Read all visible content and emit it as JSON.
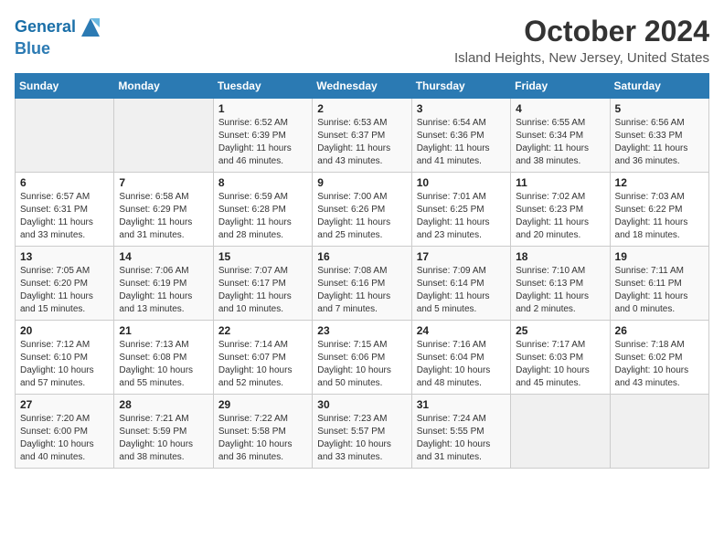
{
  "logo": {
    "line1": "General",
    "line2": "Blue"
  },
  "title": "October 2024",
  "location": "Island Heights, New Jersey, United States",
  "days_of_week": [
    "Sunday",
    "Monday",
    "Tuesday",
    "Wednesday",
    "Thursday",
    "Friday",
    "Saturday"
  ],
  "weeks": [
    [
      {
        "day": "",
        "empty": true
      },
      {
        "day": "",
        "empty": true
      },
      {
        "day": "1",
        "sunrise": "Sunrise: 6:52 AM",
        "sunset": "Sunset: 6:39 PM",
        "daylight": "Daylight: 11 hours and 46 minutes."
      },
      {
        "day": "2",
        "sunrise": "Sunrise: 6:53 AM",
        "sunset": "Sunset: 6:37 PM",
        "daylight": "Daylight: 11 hours and 43 minutes."
      },
      {
        "day": "3",
        "sunrise": "Sunrise: 6:54 AM",
        "sunset": "Sunset: 6:36 PM",
        "daylight": "Daylight: 11 hours and 41 minutes."
      },
      {
        "day": "4",
        "sunrise": "Sunrise: 6:55 AM",
        "sunset": "Sunset: 6:34 PM",
        "daylight": "Daylight: 11 hours and 38 minutes."
      },
      {
        "day": "5",
        "sunrise": "Sunrise: 6:56 AM",
        "sunset": "Sunset: 6:33 PM",
        "daylight": "Daylight: 11 hours and 36 minutes."
      }
    ],
    [
      {
        "day": "6",
        "sunrise": "Sunrise: 6:57 AM",
        "sunset": "Sunset: 6:31 PM",
        "daylight": "Daylight: 11 hours and 33 minutes."
      },
      {
        "day": "7",
        "sunrise": "Sunrise: 6:58 AM",
        "sunset": "Sunset: 6:29 PM",
        "daylight": "Daylight: 11 hours and 31 minutes."
      },
      {
        "day": "8",
        "sunrise": "Sunrise: 6:59 AM",
        "sunset": "Sunset: 6:28 PM",
        "daylight": "Daylight: 11 hours and 28 minutes."
      },
      {
        "day": "9",
        "sunrise": "Sunrise: 7:00 AM",
        "sunset": "Sunset: 6:26 PM",
        "daylight": "Daylight: 11 hours and 25 minutes."
      },
      {
        "day": "10",
        "sunrise": "Sunrise: 7:01 AM",
        "sunset": "Sunset: 6:25 PM",
        "daylight": "Daylight: 11 hours and 23 minutes."
      },
      {
        "day": "11",
        "sunrise": "Sunrise: 7:02 AM",
        "sunset": "Sunset: 6:23 PM",
        "daylight": "Daylight: 11 hours and 20 minutes."
      },
      {
        "day": "12",
        "sunrise": "Sunrise: 7:03 AM",
        "sunset": "Sunset: 6:22 PM",
        "daylight": "Daylight: 11 hours and 18 minutes."
      }
    ],
    [
      {
        "day": "13",
        "sunrise": "Sunrise: 7:05 AM",
        "sunset": "Sunset: 6:20 PM",
        "daylight": "Daylight: 11 hours and 15 minutes."
      },
      {
        "day": "14",
        "sunrise": "Sunrise: 7:06 AM",
        "sunset": "Sunset: 6:19 PM",
        "daylight": "Daylight: 11 hours and 13 minutes."
      },
      {
        "day": "15",
        "sunrise": "Sunrise: 7:07 AM",
        "sunset": "Sunset: 6:17 PM",
        "daylight": "Daylight: 11 hours and 10 minutes."
      },
      {
        "day": "16",
        "sunrise": "Sunrise: 7:08 AM",
        "sunset": "Sunset: 6:16 PM",
        "daylight": "Daylight: 11 hours and 7 minutes."
      },
      {
        "day": "17",
        "sunrise": "Sunrise: 7:09 AM",
        "sunset": "Sunset: 6:14 PM",
        "daylight": "Daylight: 11 hours and 5 minutes."
      },
      {
        "day": "18",
        "sunrise": "Sunrise: 7:10 AM",
        "sunset": "Sunset: 6:13 PM",
        "daylight": "Daylight: 11 hours and 2 minutes."
      },
      {
        "day": "19",
        "sunrise": "Sunrise: 7:11 AM",
        "sunset": "Sunset: 6:11 PM",
        "daylight": "Daylight: 11 hours and 0 minutes."
      }
    ],
    [
      {
        "day": "20",
        "sunrise": "Sunrise: 7:12 AM",
        "sunset": "Sunset: 6:10 PM",
        "daylight": "Daylight: 10 hours and 57 minutes."
      },
      {
        "day": "21",
        "sunrise": "Sunrise: 7:13 AM",
        "sunset": "Sunset: 6:08 PM",
        "daylight": "Daylight: 10 hours and 55 minutes."
      },
      {
        "day": "22",
        "sunrise": "Sunrise: 7:14 AM",
        "sunset": "Sunset: 6:07 PM",
        "daylight": "Daylight: 10 hours and 52 minutes."
      },
      {
        "day": "23",
        "sunrise": "Sunrise: 7:15 AM",
        "sunset": "Sunset: 6:06 PM",
        "daylight": "Daylight: 10 hours and 50 minutes."
      },
      {
        "day": "24",
        "sunrise": "Sunrise: 7:16 AM",
        "sunset": "Sunset: 6:04 PM",
        "daylight": "Daylight: 10 hours and 48 minutes."
      },
      {
        "day": "25",
        "sunrise": "Sunrise: 7:17 AM",
        "sunset": "Sunset: 6:03 PM",
        "daylight": "Daylight: 10 hours and 45 minutes."
      },
      {
        "day": "26",
        "sunrise": "Sunrise: 7:18 AM",
        "sunset": "Sunset: 6:02 PM",
        "daylight": "Daylight: 10 hours and 43 minutes."
      }
    ],
    [
      {
        "day": "27",
        "sunrise": "Sunrise: 7:20 AM",
        "sunset": "Sunset: 6:00 PM",
        "daylight": "Daylight: 10 hours and 40 minutes."
      },
      {
        "day": "28",
        "sunrise": "Sunrise: 7:21 AM",
        "sunset": "Sunset: 5:59 PM",
        "daylight": "Daylight: 10 hours and 38 minutes."
      },
      {
        "day": "29",
        "sunrise": "Sunrise: 7:22 AM",
        "sunset": "Sunset: 5:58 PM",
        "daylight": "Daylight: 10 hours and 36 minutes."
      },
      {
        "day": "30",
        "sunrise": "Sunrise: 7:23 AM",
        "sunset": "Sunset: 5:57 PM",
        "daylight": "Daylight: 10 hours and 33 minutes."
      },
      {
        "day": "31",
        "sunrise": "Sunrise: 7:24 AM",
        "sunset": "Sunset: 5:55 PM",
        "daylight": "Daylight: 10 hours and 31 minutes."
      },
      {
        "day": "",
        "empty": true
      },
      {
        "day": "",
        "empty": true
      }
    ]
  ]
}
